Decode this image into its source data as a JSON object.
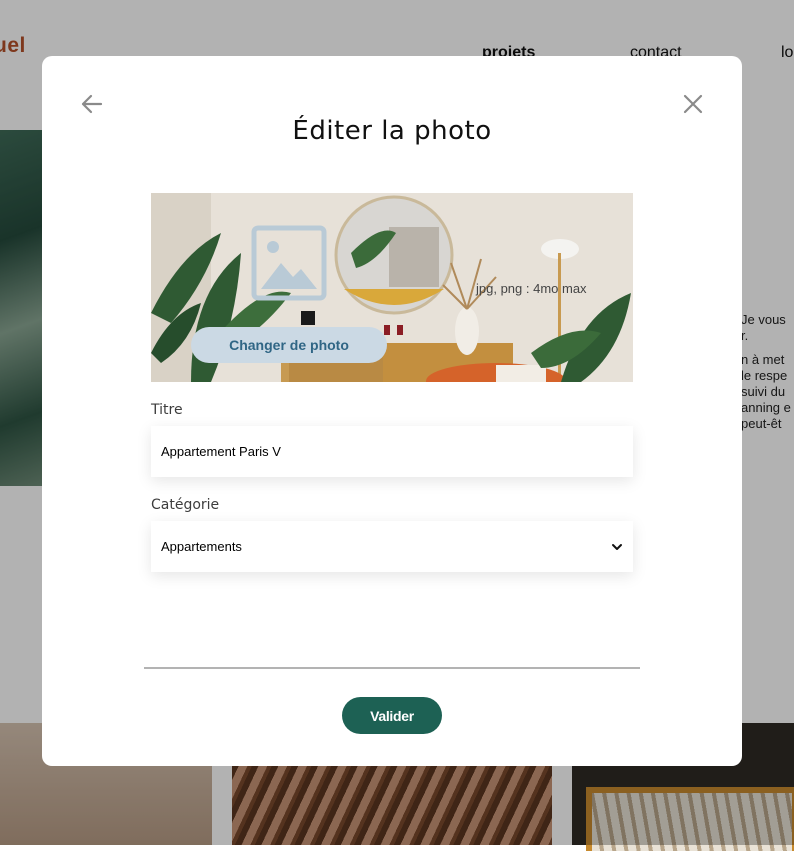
{
  "background": {
    "logo": "uel",
    "nav": {
      "projects": "projets",
      "contact": "contact",
      "login": "lo"
    },
    "text_lines": [
      "Je vous",
      "r.",
      "",
      "n à met",
      "le respe",
      "suivi du",
      "anning e",
      "peut-êt"
    ]
  },
  "modal": {
    "title": "Éditer la photo",
    "photo": {
      "change_button": "Changer de photo",
      "hint": "jpg, png : 4mo max"
    },
    "title_field": {
      "label": "Titre",
      "value": "Appartement Paris V"
    },
    "category_field": {
      "label": "Catégorie",
      "selected": "Appartements"
    },
    "submit_label": "Valider"
  },
  "colors": {
    "accent": "#1d6154",
    "logo": "#b5512a",
    "change_button_bg": "#cbd9e4",
    "change_button_text": "#306685"
  },
  "icons": {
    "back": "arrow-left-icon",
    "close": "close-icon",
    "photo_placeholder": "image-icon",
    "select": "chevron-down-icon"
  }
}
